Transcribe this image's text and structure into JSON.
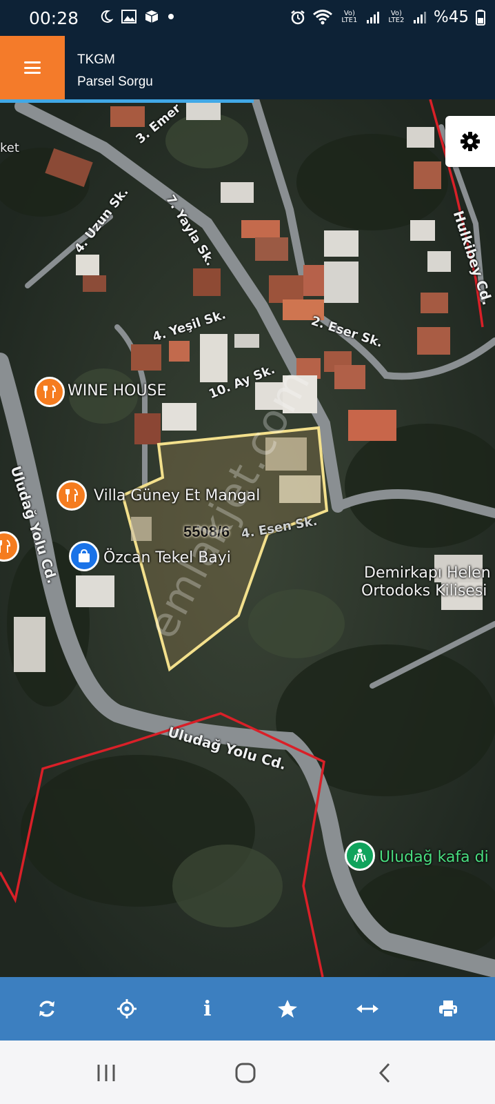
{
  "status_bar": {
    "time": "00:28",
    "net1": "Vo) LTE1",
    "net2": "Vo) LTE2",
    "battery": "%45"
  },
  "header": {
    "title": "TKGM",
    "subtitle": "Parsel Sorgu",
    "menu_icon": "hamburger-icon",
    "accent_color": "#f47b2a",
    "background_color": "#0d2236"
  },
  "map": {
    "settings_icon": "gear-icon",
    "parcel_label": "5508/6",
    "watermark": "emlakjet.com",
    "parcel_outline_color": "#f3e08c",
    "boundary_color": "#e0222a",
    "streets": {
      "emer": "3. Emer",
      "yayla": "7. Yayla Sk.",
      "uzun": "4. Uzun Sk.",
      "yesil": "4. Yeşil Sk.",
      "eser2": "2. Eser Sk.",
      "ay": "10. Ay Sk.",
      "esen": "4. Esen Sk.",
      "uludag_vertical": "Uludağ Yolu Cd.",
      "uludag_horizontal": "Uludağ Yolu Cd.",
      "hulkibey": "Hulkibey Cd.",
      "ket": "ket"
    },
    "pois": {
      "wine_house": "WINE HOUSE",
      "villa_guney": "Villa Güney Et Mangal",
      "ozcan": "Özcan Tekel Bayi",
      "kilise_line1": "Demirkapı Helen",
      "kilise_line2": "Ortodoks Kilisesi",
      "uludag_kafa": "Uludağ kafa di"
    }
  },
  "toolbar": {
    "color": "#3c7fc0",
    "buttons": [
      "refresh-icon",
      "locate-icon",
      "info-icon",
      "star-icon",
      "measure-icon",
      "print-icon"
    ],
    "info_glyph": "i"
  }
}
